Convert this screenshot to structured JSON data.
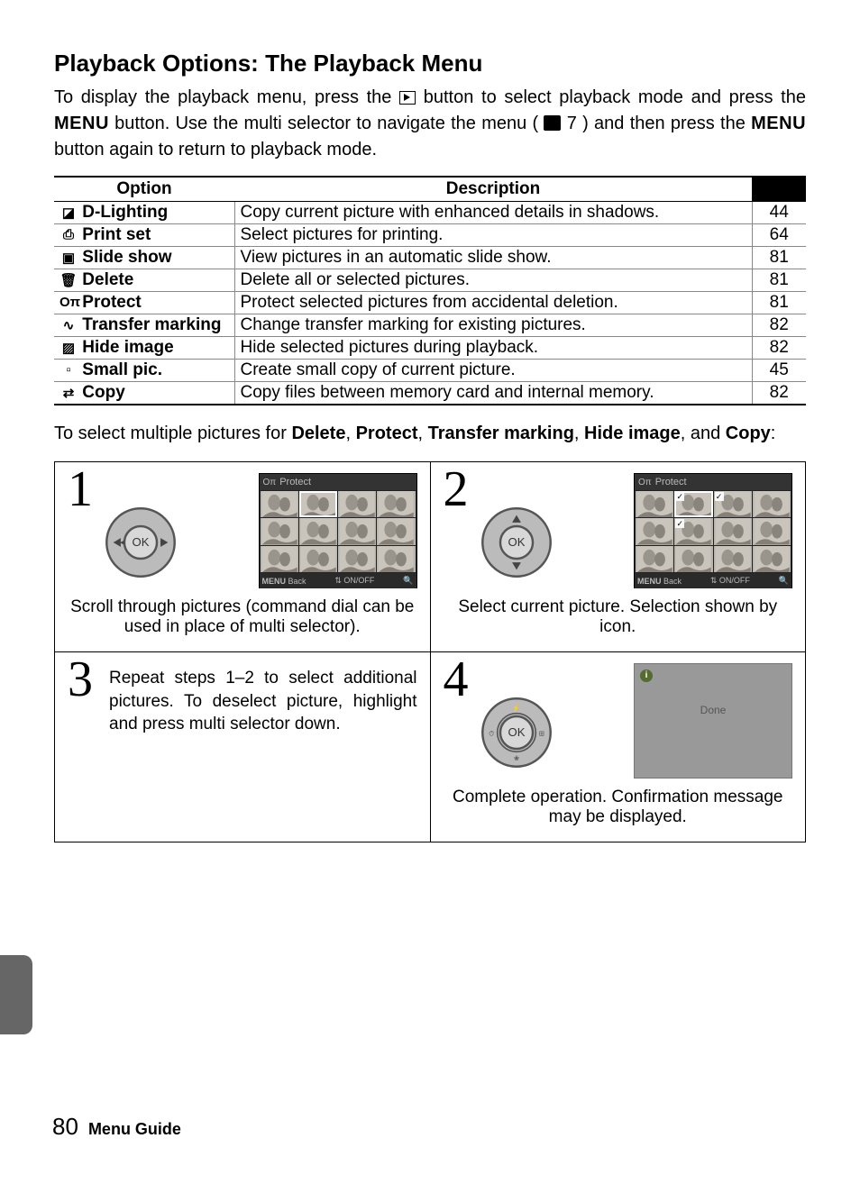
{
  "title": "Playback Options: The Playback Menu",
  "intro": {
    "part1": "To display the playback menu, press the ",
    "part2": " button to select playback mode and press the ",
    "menu1": "MENU",
    "part3": " button.  Use the multi selector to navigate the menu (",
    "pageref": "7",
    "part4": ") and then press the ",
    "menu2": "MENU",
    "part5": " button again to return to playback mode."
  },
  "table": {
    "headers": {
      "option": "Option",
      "desc": "Description"
    },
    "rows": [
      {
        "icon": "dlight-icon",
        "glyph": "◪",
        "name": "D-Lighting",
        "desc": "Copy current picture with enhanced details in shadows.",
        "page": "44"
      },
      {
        "icon": "print-icon",
        "glyph": "⎙",
        "name": "Print set",
        "desc": "Select pictures for printing.",
        "page": "64"
      },
      {
        "icon": "slideshow-icon",
        "glyph": "▣",
        "name": "Slide show",
        "desc": "View pictures in an automatic slide show.",
        "page": "81"
      },
      {
        "icon": "delete-icon",
        "glyph": "🗑",
        "name": "Delete",
        "desc": "Delete all or selected pictures.",
        "page": "81"
      },
      {
        "icon": "protect-icon",
        "glyph": "Oπ",
        "name": "Protect",
        "desc": "Protect selected pictures from accidental deletion.",
        "page": "81"
      },
      {
        "icon": "transfer-icon",
        "glyph": "∿",
        "name": "Transfer marking",
        "desc": "Change transfer marking for existing pictures.",
        "page": "82"
      },
      {
        "icon": "hide-icon",
        "glyph": "▨",
        "name": "Hide image",
        "desc": "Hide selected pictures during playback.",
        "page": "82"
      },
      {
        "icon": "smallpic-icon",
        "glyph": "▫",
        "name": "Small pic.",
        "desc": "Create small copy of current picture.",
        "page": "45"
      },
      {
        "icon": "copy-icon",
        "glyph": "⇄",
        "name": "Copy",
        "desc": "Copy files between memory card and internal memory.",
        "page": "82"
      }
    ]
  },
  "after_text": {
    "p1": "To select multiple pictures for ",
    "b1": "Delete",
    "c1": ", ",
    "b2": "Protect",
    "c2": ", ",
    "b3": "Transfer marking",
    "c3": ", ",
    "b4": "Hide image",
    "c4": ", and ",
    "b5": "Copy",
    "c5": ":"
  },
  "lcd": {
    "title": "Protect",
    "foot_left": "Back",
    "foot_menu": "MENU",
    "foot_mid": "ON/OFF",
    "done": "Done"
  },
  "steps": {
    "s1": {
      "num": "1",
      "caption": "Scroll through pictures (command dial can be used in place of multi selector)."
    },
    "s2": {
      "num": "2",
      "caption": "Select current picture.  Selection shown by icon."
    },
    "s3": {
      "num": "3",
      "text": "Repeat steps 1–2 to select additional pictures.  To deselect picture, highlight and press multi selector down."
    },
    "s4": {
      "num": "4",
      "caption": "Complete operation.  Confirmation message may be displayed."
    }
  },
  "footer": {
    "page": "80",
    "section": "Menu Guide"
  }
}
